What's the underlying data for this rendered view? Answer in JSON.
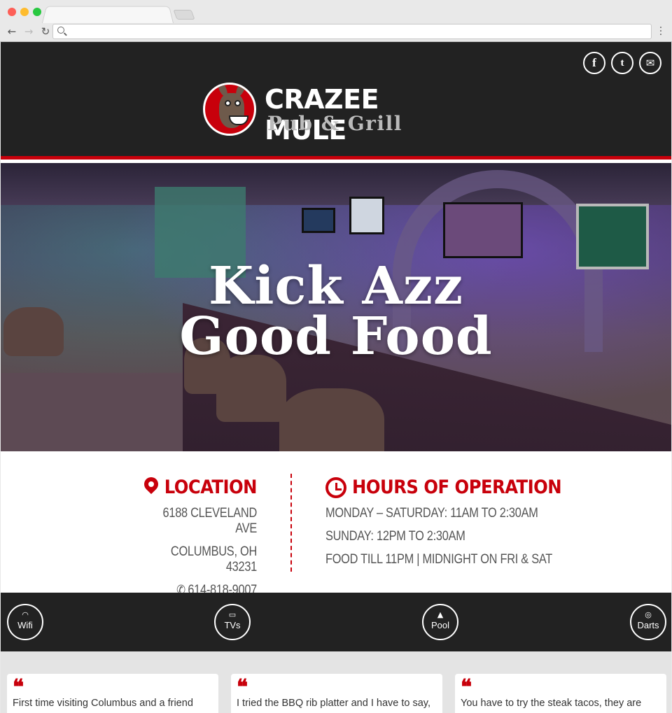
{
  "site": {
    "brand_name": "CRAZEE MULE",
    "brand_sub": "Pub & Grill",
    "social": [
      {
        "icon": "facebook-icon",
        "glyph": "f"
      },
      {
        "icon": "twitter-icon",
        "glyph": "t"
      },
      {
        "icon": "email-icon",
        "glyph": "✉"
      }
    ]
  },
  "hero": {
    "line1": "Kick Azz",
    "line2": "Good Food"
  },
  "location": {
    "heading": "Location",
    "address1": "6188 Cleveland Ave",
    "address2": "Columbus, OH 43231",
    "phone": "614-818-9007"
  },
  "hours": {
    "heading": "Hours of Operation",
    "line1": "Monday – Saturday: 11am to 2:30am",
    "line2": "Sunday: 12pm to 2:30am",
    "line3": "Food till 11pm | Midnight on Fri & Sat"
  },
  "amenities": [
    {
      "label": "Wifi",
      "icon": "wifi-icon",
      "glyph": "◠"
    },
    {
      "label": "TVs",
      "icon": "tv-icon",
      "glyph": "▭"
    },
    {
      "label": "Pool",
      "icon": "pool-triangle-icon",
      "glyph": "▲"
    },
    {
      "label": "Darts",
      "icon": "dartboard-icon",
      "glyph": "◎"
    }
  ],
  "reviews": [
    {
      "text": "First time visiting Columbus and a friend"
    },
    {
      "text": "I tried the BBQ rib platter and I have to say,"
    },
    {
      "text": "You have to try the steak tacos, they are"
    }
  ],
  "colors": {
    "accent": "#c8000b",
    "header_bg": "#222222",
    "text_gray": "#555555"
  }
}
